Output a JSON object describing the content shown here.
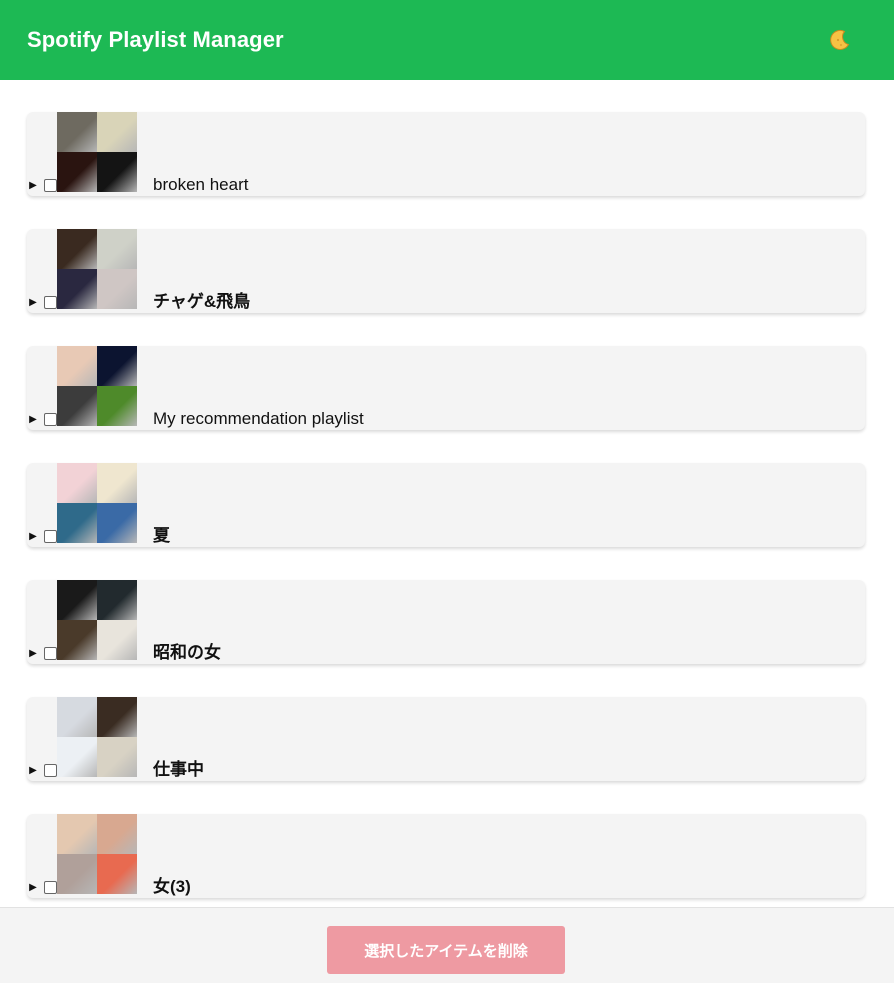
{
  "header": {
    "title": "Spotify Playlist Manager",
    "theme_icon": "moon-icon",
    "accent_color": "#1db954"
  },
  "playlists": [
    {
      "name": "broken heart",
      "covers": [
        "#6e6a60",
        "#d9d4b8",
        "#2a1410",
        "#141414"
      ]
    },
    {
      "name": "チャゲ&飛鳥",
      "covers": [
        "#3a2a20",
        "#cfd1c8",
        "#2a2840",
        "#cfc6c4"
      ]
    },
    {
      "name": "My recommendation playlist",
      "covers": [
        "#e8c9b5",
        "#0c1430",
        "#3c3c3c",
        "#4e8a2a"
      ]
    },
    {
      "name": "夏",
      "covers": [
        "#f2d2d6",
        "#efe6cf",
        "#2f6a8a",
        "#3a6aa6"
      ]
    },
    {
      "name": "昭和の女",
      "covers": [
        "#1a1a1a",
        "#222a2e",
        "#4a3a2a",
        "#e8e4dc"
      ]
    },
    {
      "name": "仕事中",
      "covers": [
        "#d6dae0",
        "#3a2c22",
        "#ecf0f4",
        "#d8d2c4"
      ]
    },
    {
      "name": "女(3)",
      "covers": [
        "#e4c8b0",
        "#d8a890",
        "#b0a09a",
        "#e86a50"
      ]
    }
  ],
  "footer": {
    "delete_label": "選択したアイテムを削除",
    "delete_color": "#ee9aa2"
  }
}
